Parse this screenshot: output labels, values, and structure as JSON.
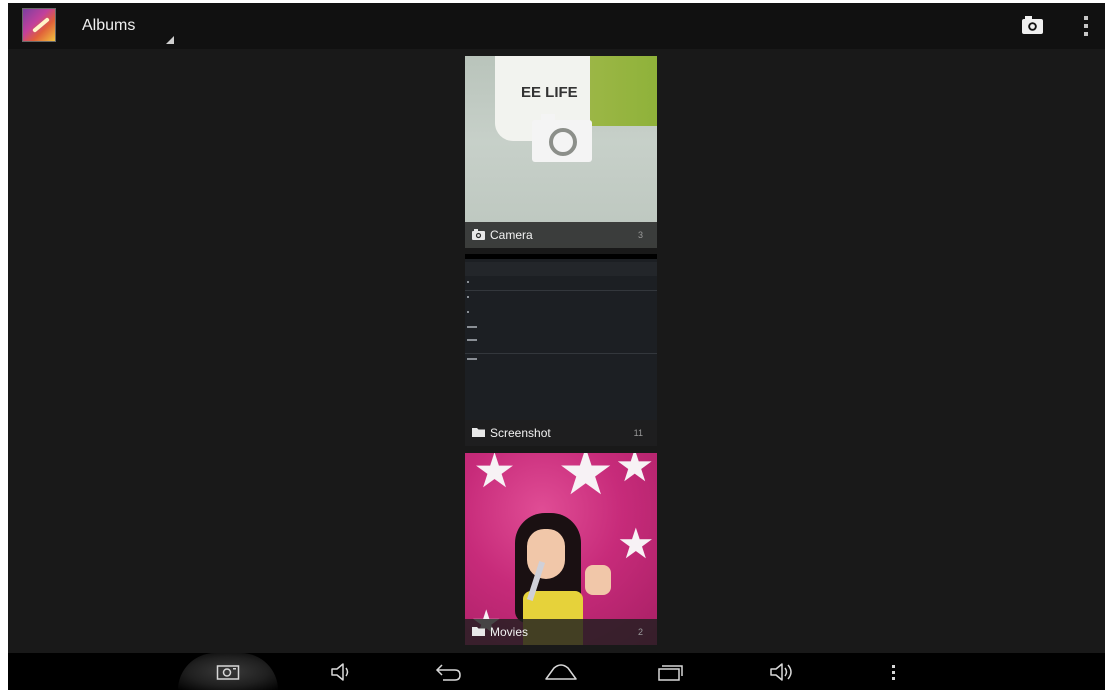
{
  "action_bar": {
    "title": "Albums",
    "app_icon": "gallery-icon",
    "actions": [
      {
        "icon": "camera-icon"
      },
      {
        "icon": "overflow-menu-icon"
      }
    ]
  },
  "albums": [
    {
      "name": "Camera",
      "count": "3",
      "icon": "camera-icon"
    },
    {
      "name": "Screenshot",
      "count": "11",
      "icon": "folder-icon"
    },
    {
      "name": "Movies",
      "count": "2",
      "icon": "folder-icon"
    }
  ],
  "nav_bar": {
    "buttons": [
      "screenshot-icon",
      "volume-down-icon",
      "back-icon",
      "home-icon",
      "recents-icon",
      "volume-up-icon",
      "menu-icon"
    ]
  },
  "colors": {
    "background": "#191919",
    "action_bar": "#111111",
    "nav_bar": "#000000",
    "label_text": "#f2f2f2",
    "count_text": "#9a9a9a"
  }
}
